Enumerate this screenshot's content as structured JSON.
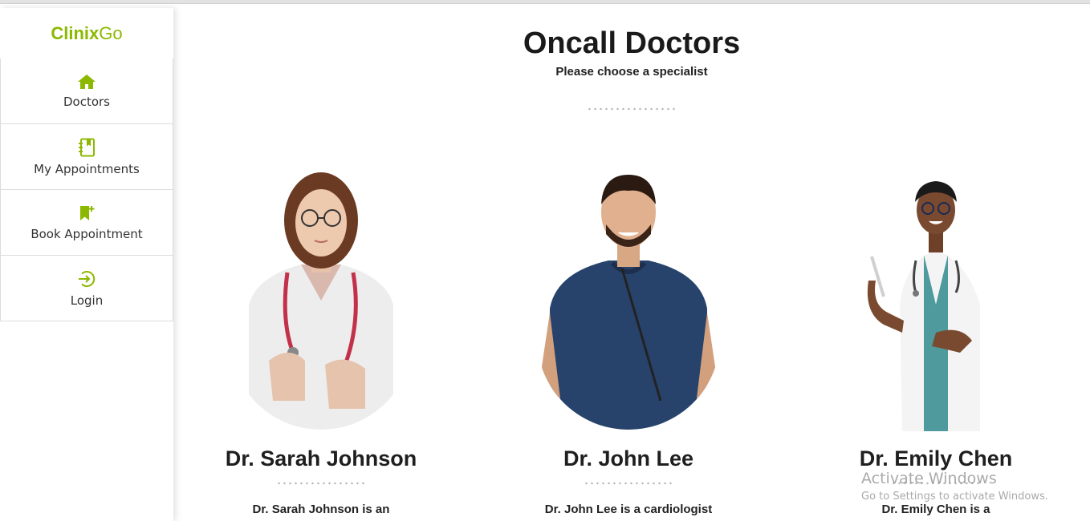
{
  "brand": {
    "main": "Clinix",
    "suffix": "Go",
    "color": "#8cb800"
  },
  "sidebar": {
    "items": [
      {
        "label": "Doctors",
        "icon": "home-icon"
      },
      {
        "label": "My Appointments",
        "icon": "notebook-icon"
      },
      {
        "label": "Book Appointment",
        "icon": "bookmark-plus-icon"
      },
      {
        "label": "Login",
        "icon": "login-icon"
      }
    ]
  },
  "main": {
    "title": "Oncall Doctors",
    "subtitle": "Please choose a specialist"
  },
  "doctors": [
    {
      "name": "Dr. Sarah Johnson",
      "description": "Dr. Sarah Johnson is an"
    },
    {
      "name": "Dr. John Lee",
      "description": "Dr. John Lee is a cardiologist"
    },
    {
      "name": "Dr. Emily Chen",
      "description": "Dr. Emily Chen is a"
    }
  ],
  "watermark": {
    "line1": "Activate Windows",
    "line2": "Go to Settings to activate Windows."
  }
}
